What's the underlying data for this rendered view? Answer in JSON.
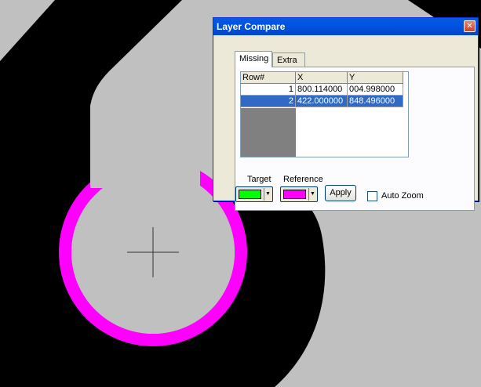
{
  "dialog": {
    "title": "Layer Compare",
    "tabs": [
      "Missing",
      "Extra"
    ],
    "active_tab": "Missing",
    "table": {
      "columns": [
        "Row#",
        "X",
        "Y"
      ],
      "rows": [
        {
          "row": "1",
          "x": "800.114000",
          "y": "004.998000",
          "selected": false
        },
        {
          "row": "2",
          "x": "422.000000",
          "y": "848.496000",
          "selected": true
        }
      ]
    },
    "target_label": "Target",
    "reference_label": "Reference",
    "target_color": "#00ff00",
    "reference_color": "#ff00ff",
    "apply_label": "Apply",
    "auto_zoom_label": "Auto Zoom",
    "auto_zoom_checked": false
  },
  "canvas": {
    "background_color": "#c0c0c0",
    "trace_color": "#000000",
    "ring_color": "#ff00ff"
  },
  "icons": {
    "close": "close-icon",
    "dropdown": "dropdown-arrow-icon",
    "crosshair": "crosshair-icon"
  }
}
